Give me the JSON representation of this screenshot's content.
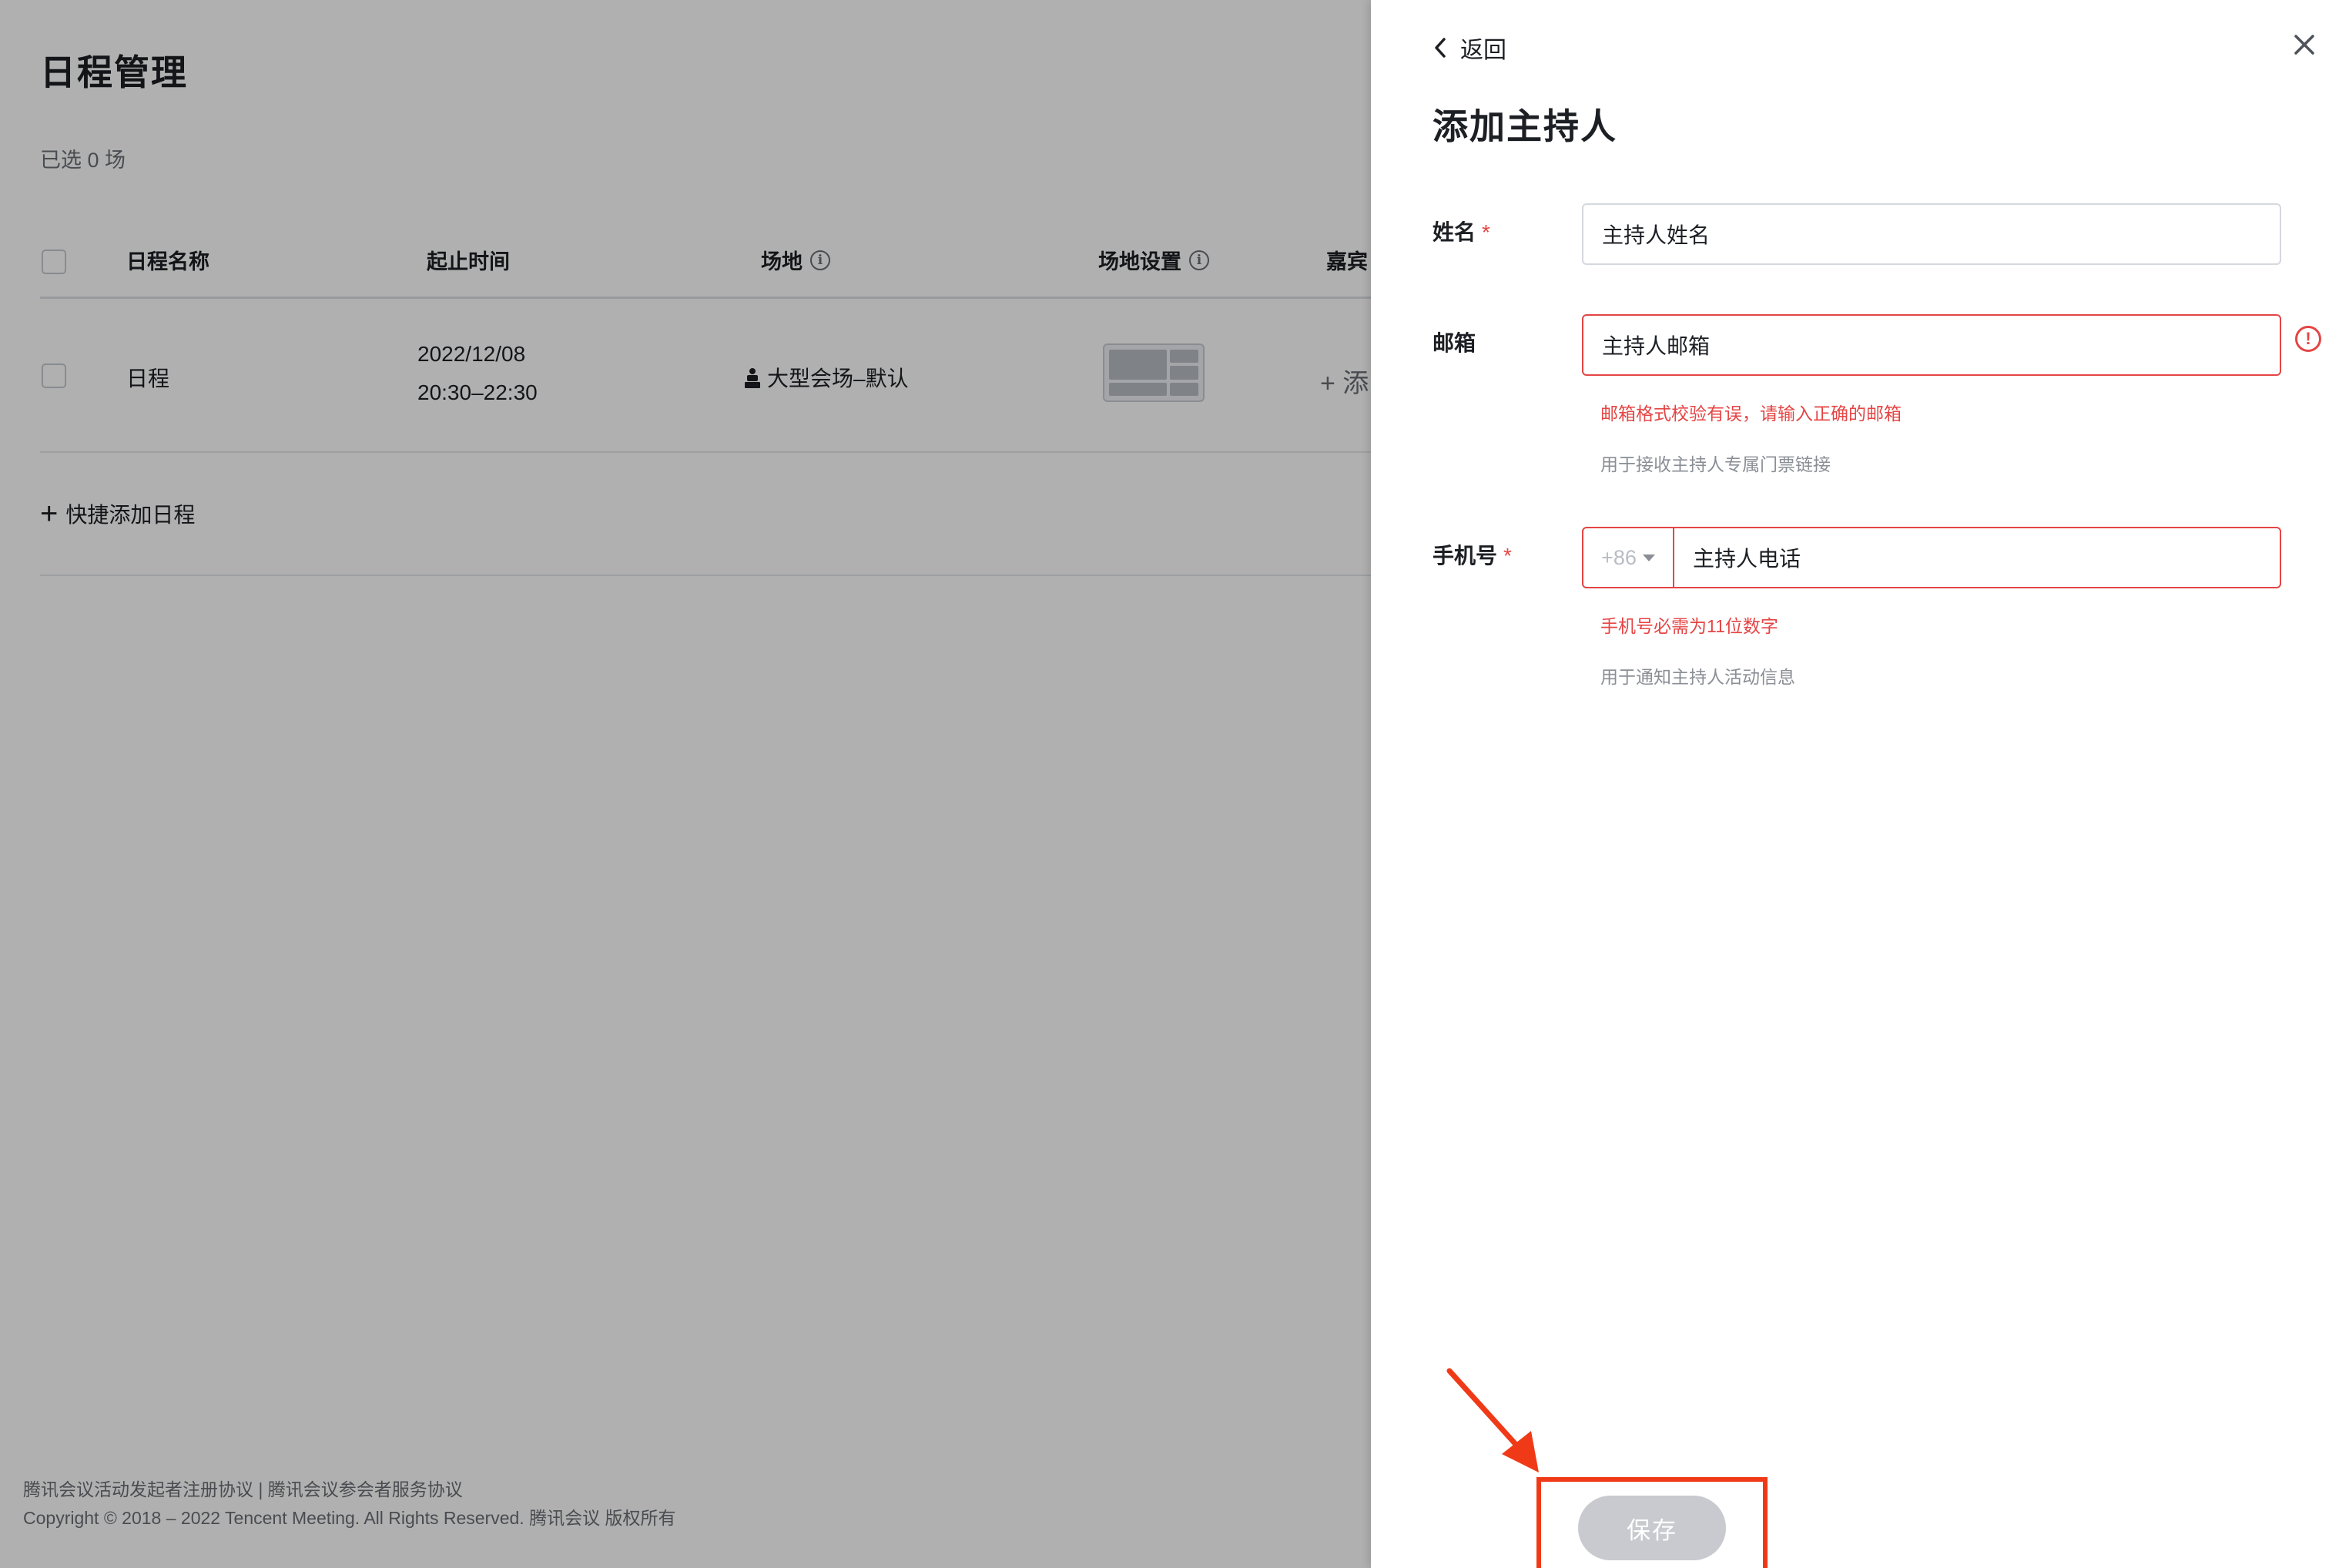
{
  "page": {
    "title": "日程管理",
    "selected_count": "已选 0 场"
  },
  "table": {
    "columns": [
      "日程名称",
      "起止时间",
      "场地",
      "场地设置",
      "嘉宾"
    ],
    "rows": [
      {
        "name": "日程",
        "date": "2022/12/08",
        "time": "20:30–22:30",
        "venue": "大型会场–默认"
      }
    ],
    "add_guest_glyph": "+ 添"
  },
  "quick_add_label": "快捷添加日程",
  "footer": {
    "line1": "腾讯会议活动发起者注册协议 | 腾讯会议参会者服务协议",
    "line2": "Copyright © 2018 – 2022 Tencent Meeting. All Rights Reserved. 腾讯会议 版权所有"
  },
  "panel": {
    "back_label": "返回",
    "title": "添加主持人",
    "fields": {
      "name": {
        "label": "姓名",
        "required_mark": "*",
        "value": "主持人姓名"
      },
      "email": {
        "label": "邮箱",
        "value": "主持人邮箱",
        "error": "邮箱格式校验有误，请输入正确的邮箱",
        "hint": "用于接收主持人专属门票链接"
      },
      "phone": {
        "label": "手机号",
        "required_mark": "*",
        "country_code": "+86",
        "value": "主持人电话",
        "error": "手机号必需为11位数字",
        "hint": "用于通知主持人活动信息"
      }
    },
    "save_label": "保存"
  },
  "colors": {
    "error": "#e54545",
    "highlight": "#f03a17",
    "disabled_button": "#c9cacf"
  }
}
